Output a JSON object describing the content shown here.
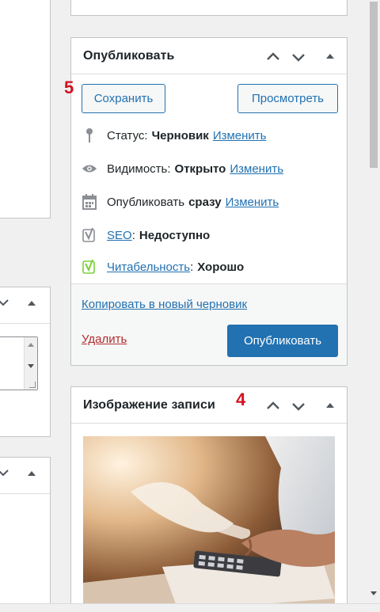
{
  "publish_box": {
    "title": "Опубликовать",
    "save_label": "Сохранить",
    "preview_label": "Просмотреть",
    "annotation_number": "5",
    "status": {
      "label": "Статус:",
      "value": "Черновик",
      "link": "Изменить"
    },
    "visibility": {
      "label": "Видимость:",
      "value": "Открыто",
      "link": "Изменить"
    },
    "schedule": {
      "label": "Опубликовать",
      "value": "сразу",
      "link": "Изменить"
    },
    "seo": {
      "link": "SEO",
      "value": "Недоступно"
    },
    "readability": {
      "link": "Читабельность",
      "value": "Хорошо"
    },
    "copy_draft_link": "Копировать в новый черновик",
    "delete_link": "Удалить",
    "publish_label": "Опубликовать"
  },
  "featured_image_box": {
    "title": "Изображение записи",
    "annotation_number": "4"
  },
  "icons": {
    "move_up": "chevron-up-icon",
    "move_down": "chevron-down-icon",
    "toggle": "triangle-up-icon",
    "status": "pin-icon",
    "visibility": "eye-icon",
    "schedule": "calendar-icon",
    "seo": "yoast-icon",
    "readability": "yoast-icon"
  },
  "colors": {
    "accent": "#2271b1",
    "annotation": "#d0121f",
    "delete": "#b32d2e",
    "readability_good": "#7ad03a",
    "seo_inactive": "#8c8f94"
  }
}
